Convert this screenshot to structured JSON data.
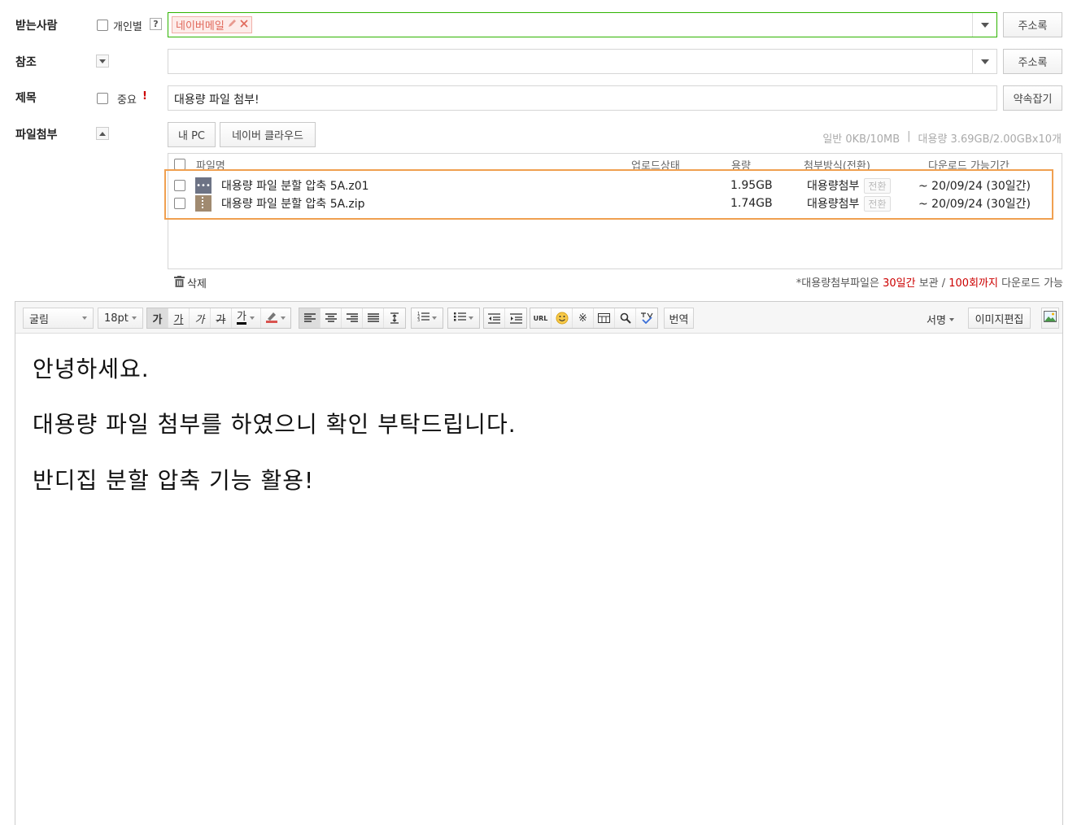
{
  "recipient": {
    "label": "받는사람",
    "individual_label": "개인별",
    "help_label": "?",
    "chip_text": "네이버메일",
    "address_book_label": "주소록"
  },
  "cc": {
    "label": "참조",
    "address_book_label": "주소록"
  },
  "subject": {
    "label": "제목",
    "important_label": "중요",
    "important_mark": "!",
    "value": "대용량 파일 첨부!",
    "reserve_label": "약속잡기"
  },
  "attachment": {
    "label": "파일첨부",
    "my_pc_label": "내 PC",
    "cloud_label": "네이버 클라우드",
    "quota_normal": "일반 0KB/10MB",
    "quota_separator": "|",
    "quota_large": "대용량 3.69GB/2.00GBx10개",
    "columns": [
      "파일명",
      "업로드상태",
      "용량",
      "첨부방식(전환)",
      "다운로드 가능기간"
    ],
    "files": [
      {
        "name": "대용량 파일 분할 압축 5A.z01",
        "size": "1.95GB",
        "method": "대용량첨부",
        "convert": "전환",
        "period": "~ 20/09/24 (30일간)",
        "icon": "archive-part-icon"
      },
      {
        "name": "대용량 파일 분할 압축 5A.zip",
        "size": "1.74GB",
        "method": "대용량첨부",
        "convert": "전환",
        "period": "~ 20/09/24 (30일간)",
        "icon": "zip-file-icon"
      }
    ],
    "delete_label": "삭제",
    "notice_prefix": "*대용량첨부파일은 ",
    "notice_days": "30일간",
    "notice_mid": " 보관 / ",
    "notice_count": "100회까지",
    "notice_suffix": " 다운로드 가능"
  },
  "toolbar": {
    "font": "굴림",
    "size": "18pt",
    "bold": "가",
    "underline": "가",
    "italic": "가",
    "strike": "가",
    "font_color": "가",
    "translate_label": "번역",
    "url_label": "URL",
    "signature_label": "서명",
    "image_edit_label": "이미지편집"
  },
  "body": {
    "lines": [
      "안녕하세요.",
      "대용량 파일 첨부를 하였으니 확인 부탁드립니다.",
      "반디집 분할 압축 기능 활용!"
    ]
  },
  "colors": {
    "accent_green": "#2eb400",
    "highlight_orange": "#f0a050",
    "chip_red": "#e0685a",
    "notice_red": "#cc0000"
  }
}
